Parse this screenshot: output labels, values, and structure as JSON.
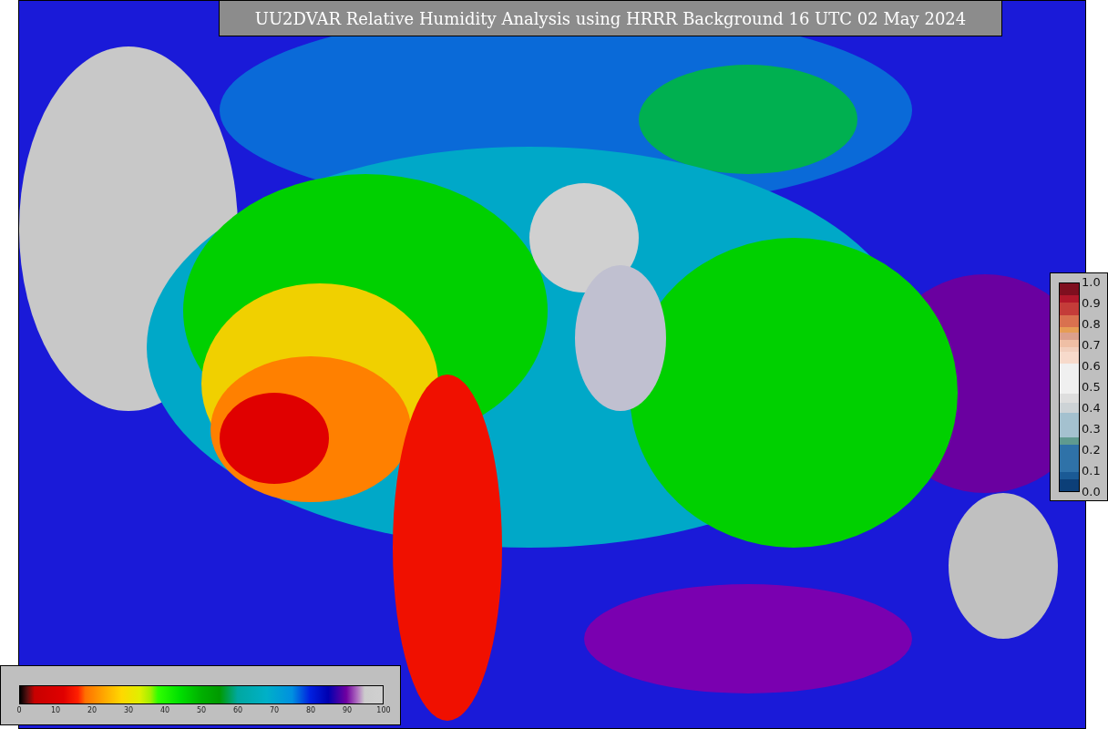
{
  "title": "UU2DVAR Relative Humidity Analysis using HRRR Background 16 UTC 02 May 2024",
  "observation_legend": {
    "ticks": [
      "1.0",
      "0.9",
      "0.8",
      "0.7",
      "0.6",
      "0.5",
      "0.4",
      "0.3",
      "0.2",
      "0.1",
      "0.0"
    ]
  },
  "humidity_legend": {
    "ticks": [
      "0",
      "10",
      "20",
      "30",
      "40",
      "50",
      "60",
      "70",
      "80",
      "90",
      "100"
    ]
  }
}
